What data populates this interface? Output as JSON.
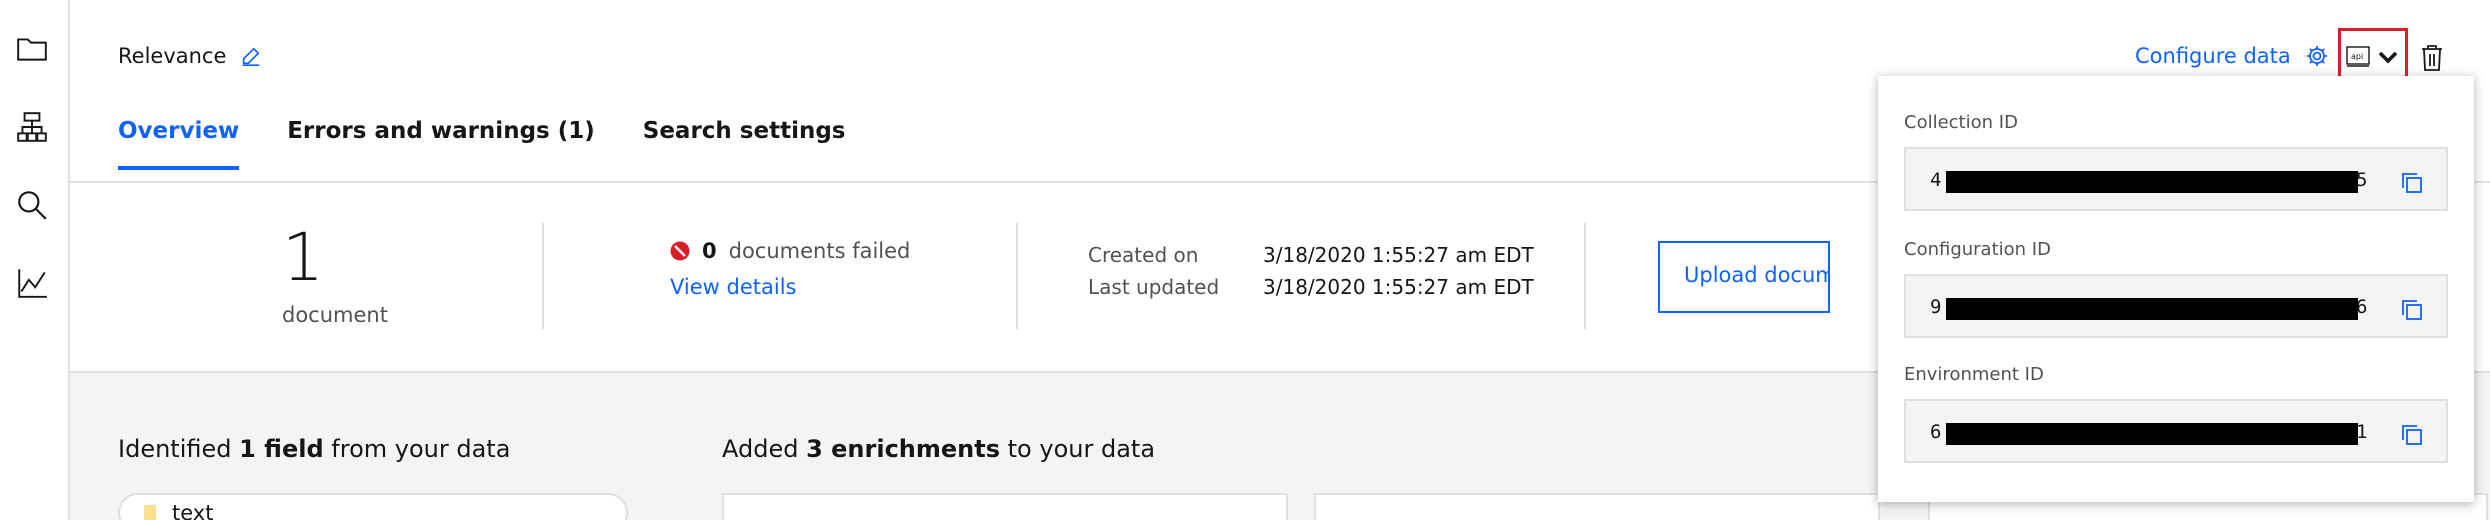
{
  "rail": {
    "icons": [
      "folder-icon",
      "hierarchy-icon",
      "search-icon",
      "analytics-icon"
    ]
  },
  "header": {
    "title": "Relevance",
    "configure_label": "Configure data",
    "tabs": [
      {
        "label": "Overview",
        "active": true
      },
      {
        "label": "Errors and warnings (1)",
        "active": false
      },
      {
        "label": "Search settings",
        "active": false
      }
    ]
  },
  "stats": {
    "document_count": "1",
    "document_label": "document",
    "failed_count": "0",
    "failed_label": "documents failed",
    "view_details": "View details",
    "created_label": "Created on",
    "created_value": "3/18/2020 1:55:27 am EDT",
    "updated_label": "Last updated",
    "updated_value": "3/18/2020 1:55:27 am EDT",
    "upload_label": "Upload documents"
  },
  "lower": {
    "identified_prefix": "Identified ",
    "identified_bold": "1 field",
    "identified_suffix": " from your data",
    "added_prefix": "Added ",
    "added_bold": "3 enrichments",
    "added_suffix": " to your data",
    "field_chip": "text"
  },
  "popover": {
    "collection_label": "Collection ID",
    "collection_start": "4",
    "collection_end": "5",
    "configuration_label": "Configuration ID",
    "configuration_start": "9",
    "configuration_end": "6",
    "environment_label": "Environment ID",
    "environment_start": "6",
    "environment_end": "1"
  },
  "colors": {
    "accent": "#0f62fe",
    "error": "#da1e28",
    "redacted": "#000000"
  }
}
